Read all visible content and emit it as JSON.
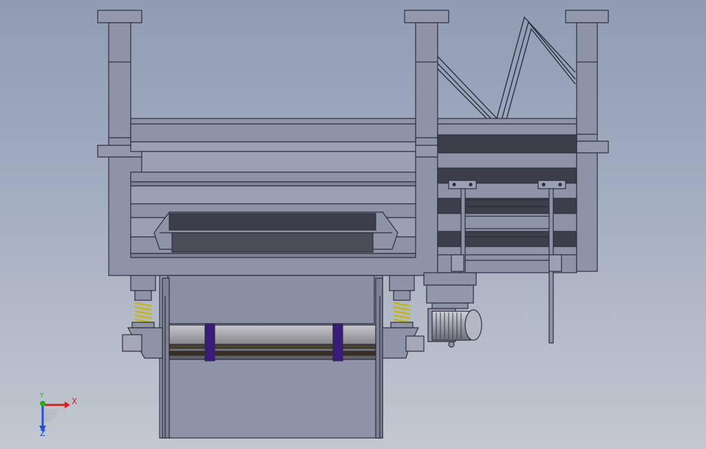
{
  "viewport": {
    "background_top": "#8f9cb4",
    "background_bottom": "#c3c8d0"
  },
  "colors": {
    "frame_fill": "#8e93a8",
    "frame_stroke": "#2b2e3a",
    "dark_panel": "#3c3f4a",
    "spring_coil": "#e2d400",
    "roller_band": "#3a1a7a",
    "motor_fill": "#9ea2ae"
  },
  "triad": {
    "x_label": "X",
    "y_label": "Y",
    "z_label": "Z",
    "x_color": "#d42020",
    "y_color": "#20b020",
    "z_color": "#2050d8"
  },
  "icons": [
    "coordinate-triad-icon"
  ]
}
